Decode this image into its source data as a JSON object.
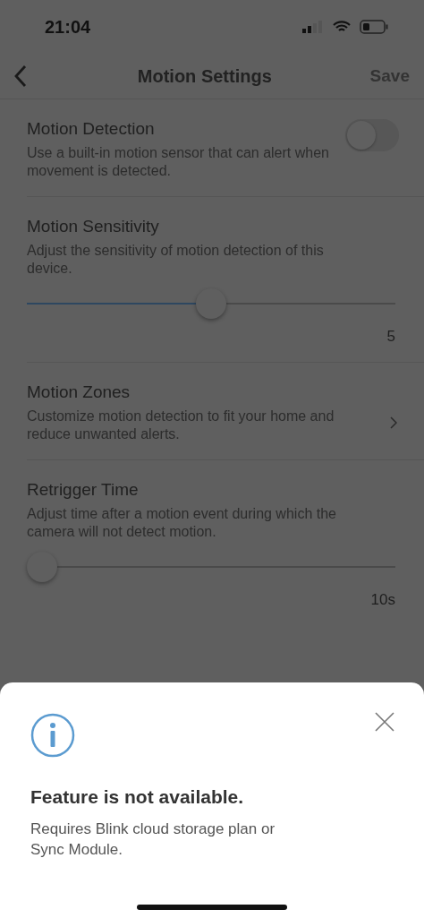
{
  "status_bar": {
    "time": "21:04"
  },
  "nav": {
    "title": "Motion Settings",
    "action": "Save",
    "action_disabled": true
  },
  "settings": [
    {
      "kind": "toggle",
      "title": "Motion Detection",
      "description": "Use a built-in motion sensor that can alert when movement is detected.",
      "on": false
    },
    {
      "kind": "slider",
      "title": "Motion Sensitivity",
      "description": "Adjust the sensitivity of motion detection of this device.",
      "level": 0.5,
      "reading": "5"
    },
    {
      "kind": "link",
      "title": "Motion Zones",
      "description": "Customize motion detection to fit your home and reduce unwanted alerts."
    },
    {
      "kind": "slider",
      "title": "Retrigger Time",
      "description": "Adjust time after a motion event during which the camera will not detect motion.",
      "level": 0,
      "reading": "10s"
    }
  ],
  "sheet": {
    "title": "Feature is not available.",
    "message": "Requires Blink cloud storage plan or Sync Module."
  }
}
